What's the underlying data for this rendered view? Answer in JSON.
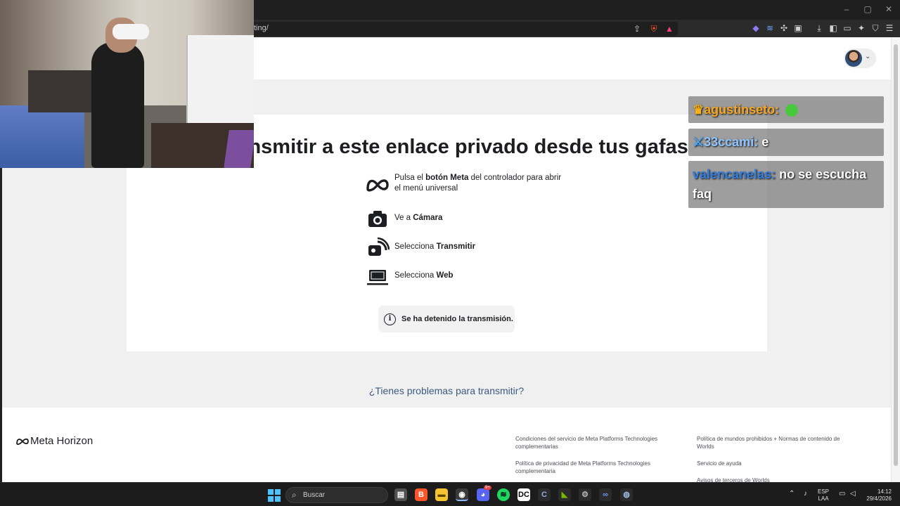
{
  "browser": {
    "url": "ting/",
    "window_controls": {
      "minimize": "–",
      "maximize": "▢",
      "close": "✕"
    }
  },
  "page": {
    "headline": "a transmitir a este enlace privado desde tus gafas",
    "steps": [
      {
        "icon": "meta-logo-icon",
        "text_pre": "Pulsa el ",
        "bold": "botón Meta",
        "text_post": " del controlador para abrir el menú universal"
      },
      {
        "icon": "camera-icon",
        "text_pre": "Ve a ",
        "bold": "Cámara",
        "text_post": ""
      },
      {
        "icon": "cast-icon",
        "text_pre": "Selecciona ",
        "bold": "Transmitir",
        "text_post": ""
      },
      {
        "icon": "laptop-icon",
        "text_pre": "Selecciona ",
        "bold": "Web",
        "text_post": ""
      }
    ],
    "status_text": "Se ha detenido la transmisión.",
    "help_link": "¿Tienes problemas para transmitir?"
  },
  "footer": {
    "logo_text": "Meta Horizon",
    "links": [
      "Condiciones del servicio de Meta Platforms Technologies complementarias",
      "Política de privacidad de Meta Platforms Technologies complementaria",
      "Política de mundos prohibidos + Normas de contenido de Worlds",
      "Servicio de ayuda",
      "Avisos de terceros de Worlds"
    ]
  },
  "chat": [
    {
      "user": "agustinseto",
      "message": ""
    },
    {
      "user": "33ccami",
      "message": "e"
    },
    {
      "user": "valencanelas",
      "message": "no se escucha faq"
    }
  ],
  "taskbar": {
    "search_placeholder": "Buscar",
    "language": "ESP",
    "layout": "LAA",
    "time": "14:12",
    "date": "29/4/2026",
    "discord_badge": "9+"
  },
  "colors": {
    "accent_link": "#3b5a80",
    "chat_gold": "#f6a623",
    "chat_blue": "#2f7de1"
  }
}
